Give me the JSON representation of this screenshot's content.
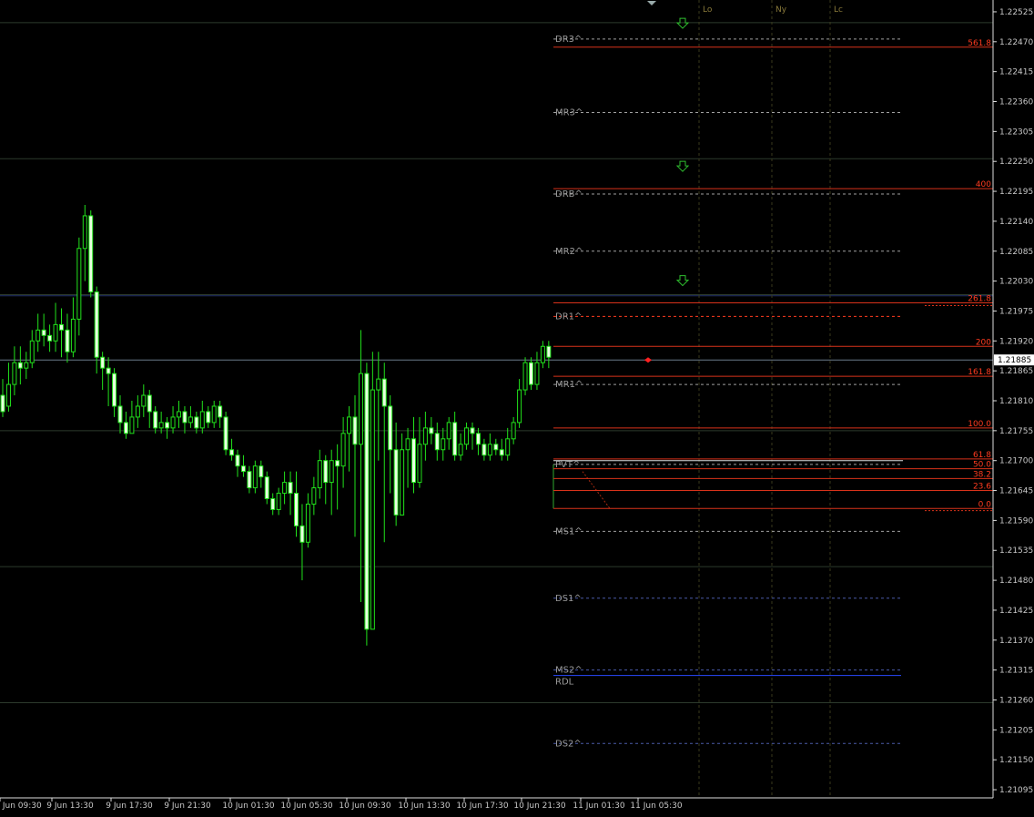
{
  "chart_data": {
    "type": "candlestick",
    "x_tick_labels": [
      "9 Jun 09:30",
      "9 Jun 13:30",
      "9 Jun 17:30",
      "9 Jun 21:30",
      "10 Jun 01:30",
      "10 Jun 05:30",
      "10 Jun 09:30",
      "10 Jun 13:30",
      "10 Jun 17:30",
      "10 Jun 21:30",
      "11 Jun 01:30",
      "11 Jun 05:30"
    ],
    "y_tick_labels": [
      "1.22525",
      "1.22470",
      "1.22415",
      "1.22360",
      "1.22305",
      "1.22250",
      "1.22195",
      "1.22140",
      "1.22085",
      "1.22030",
      "1.21975",
      "1.21920",
      "1.21865",
      "1.21810",
      "1.21755",
      "1.21700",
      "1.21645",
      "1.21590",
      "1.21535",
      "1.21480",
      "1.21425",
      "1.21370",
      "1.21315",
      "1.21260",
      "1.21205",
      "1.21150",
      "1.21095"
    ],
    "ylim": [
      1.2108,
      1.2254
    ],
    "current_price": "1.21885",
    "current_price_value": 1.21885,
    "pivot_levels": [
      {
        "label": "DR3^",
        "value": 1.22475,
        "color": "#a0a0a0",
        "style": "dashed"
      },
      {
        "label": "MR3^",
        "value": 1.2234,
        "color": "#a0a0a0",
        "style": "dashed"
      },
      {
        "label": "DRB^",
        "value": 1.2219,
        "color": "#a0a0a0",
        "style": "dashed"
      },
      {
        "label": "MR2^",
        "value": 1.22085,
        "color": "#a0a0a0",
        "style": "dashed"
      },
      {
        "label": "DR1^",
        "value": 1.21965,
        "color": "#ff3b1f",
        "style": "dashed"
      },
      {
        "label": "MR1^",
        "value": 1.2184,
        "color": "#a0a0a0",
        "style": "dashed"
      },
      {
        "label": "PVT^",
        "value": 1.21693,
        "color": "#a0a0a0",
        "style": "dashed"
      },
      {
        "label": "MS1^",
        "value": 1.2157,
        "color": "#a0a0a0",
        "style": "dashed"
      },
      {
        "label": "DS1^",
        "value": 1.21447,
        "color": "#4a5aa8",
        "style": "dashed"
      },
      {
        "label": "MS2^",
        "value": 1.21315,
        "color": "#4a5aa8",
        "style": "dashed"
      },
      {
        "label": "RDL",
        "value": 1.21305,
        "color": "#2a4aff",
        "style": "solid"
      },
      {
        "label": "DS2^",
        "value": 1.2118,
        "color": "#4a5aa8",
        "style": "dashed"
      }
    ],
    "fib_levels": [
      {
        "label": "561.8",
        "value": 1.2246
      },
      {
        "label": "400",
        "value": 1.222
      },
      {
        "label": "261.8",
        "value": 1.2199
      },
      {
        "label": "200",
        "value": 1.2191
      },
      {
        "label": "161.8",
        "value": 1.21855
      },
      {
        "label": "100.0",
        "value": 1.2176
      },
      {
        "label": "61.8",
        "value": 1.21703
      },
      {
        "label": "50.0",
        "value": 1.21685
      },
      {
        "label": "38.2",
        "value": 1.21667
      },
      {
        "label": "23.6",
        "value": 1.21645
      },
      {
        "label": "0.0",
        "value": 1.21612
      }
    ],
    "session_labels": [
      "Lo",
      "Ny",
      "Lc"
    ],
    "horizontal_grid_values": [
      1.22505,
      1.22255,
      1.22005,
      1.21755,
      1.21505,
      1.21255
    ],
    "candles": [
      [
        1.2182,
        1.2179,
        1.2185,
        1.2178
      ],
      [
        1.218,
        1.2184,
        1.2188,
        1.2179
      ],
      [
        1.2184,
        1.2188,
        1.2191,
        1.2182
      ],
      [
        1.2188,
        1.2187,
        1.2191,
        1.2184
      ],
      [
        1.2187,
        1.2188,
        1.219,
        1.2185
      ],
      [
        1.2188,
        1.2192,
        1.2194,
        1.2187
      ],
      [
        1.2192,
        1.2194,
        1.2197,
        1.219
      ],
      [
        1.2194,
        1.2193,
        1.2197,
        1.2191
      ],
      [
        1.2193,
        1.2192,
        1.2195,
        1.219
      ],
      [
        1.2192,
        1.2195,
        1.2199,
        1.219
      ],
      [
        1.2195,
        1.2194,
        1.2198,
        1.2189
      ],
      [
        1.2194,
        1.219,
        1.2197,
        1.2188
      ],
      [
        1.219,
        1.2196,
        1.22,
        1.2189
      ],
      [
        1.2196,
        1.2209,
        1.2211,
        1.2193
      ],
      [
        1.2209,
        1.2215,
        1.2217,
        1.2203
      ],
      [
        1.2215,
        1.2201,
        1.2216,
        1.22
      ],
      [
        1.2201,
        1.2189,
        1.2202,
        1.2186
      ],
      [
        1.2189,
        1.2187,
        1.219,
        1.2183
      ],
      [
        1.2187,
        1.2186,
        1.2189,
        1.218
      ],
      [
        1.2186,
        1.218,
        1.2187,
        1.2178
      ],
      [
        1.218,
        1.2177,
        1.2182,
        1.2175
      ],
      [
        1.2177,
        1.2175,
        1.2179,
        1.2174
      ],
      [
        1.2175,
        1.2178,
        1.2181,
        1.2175
      ],
      [
        1.2178,
        1.218,
        1.2182,
        1.2176
      ],
      [
        1.218,
        1.2182,
        1.2184,
        1.2178
      ],
      [
        1.2182,
        1.2179,
        1.2183,
        1.2176
      ],
      [
        1.2179,
        1.2176,
        1.218,
        1.2175
      ],
      [
        1.2176,
        1.2177,
        1.2179,
        1.2175
      ],
      [
        1.2177,
        1.2176,
        1.2178,
        1.2174
      ],
      [
        1.2176,
        1.2178,
        1.218,
        1.2175
      ],
      [
        1.2178,
        1.2179,
        1.2181,
        1.2176
      ],
      [
        1.2179,
        1.2177,
        1.218,
        1.2175
      ],
      [
        1.2177,
        1.2178,
        1.218,
        1.2176
      ],
      [
        1.2178,
        1.2176,
        1.2179,
        1.2175
      ],
      [
        1.2176,
        1.2179,
        1.2181,
        1.2175
      ],
      [
        1.2179,
        1.2177,
        1.218,
        1.2176
      ],
      [
        1.2177,
        1.218,
        1.2181,
        1.2176
      ],
      [
        1.218,
        1.2178,
        1.2181,
        1.2176
      ],
      [
        1.2178,
        1.2172,
        1.2179,
        1.2171
      ],
      [
        1.2172,
        1.2171,
        1.2174,
        1.217
      ],
      [
        1.2171,
        1.2169,
        1.2172,
        1.2167
      ],
      [
        1.2169,
        1.2168,
        1.2171,
        1.2167
      ],
      [
        1.2168,
        1.2165,
        1.2169,
        1.2164
      ],
      [
        1.2165,
        1.2169,
        1.217,
        1.2164
      ],
      [
        1.2169,
        1.2167,
        1.217,
        1.2165
      ],
      [
        1.2167,
        1.2163,
        1.2168,
        1.2162
      ],
      [
        1.2163,
        1.2161,
        1.2164,
        1.216
      ],
      [
        1.2161,
        1.2164,
        1.2165,
        1.216
      ],
      [
        1.2164,
        1.2166,
        1.2168,
        1.2162
      ],
      [
        1.2166,
        1.2164,
        1.2168,
        1.216
      ],
      [
        1.2164,
        1.2158,
        1.2168,
        1.2156
      ],
      [
        1.2158,
        1.2155,
        1.2162,
        1.2148
      ],
      [
        1.2155,
        1.2162,
        1.2164,
        1.2154
      ],
      [
        1.2162,
        1.2165,
        1.2167,
        1.216
      ],
      [
        1.2165,
        1.217,
        1.2172,
        1.2163
      ],
      [
        1.217,
        1.2166,
        1.2171,
        1.2162
      ],
      [
        1.2166,
        1.217,
        1.2172,
        1.216
      ],
      [
        1.217,
        1.2169,
        1.2173,
        1.2161
      ],
      [
        1.2169,
        1.2175,
        1.2178,
        1.2165
      ],
      [
        1.2175,
        1.2178,
        1.218,
        1.2168
      ],
      [
        1.2178,
        1.2173,
        1.2182,
        1.2156
      ],
      [
        1.2173,
        1.2186,
        1.2194,
        1.2144
      ],
      [
        1.2186,
        1.2139,
        1.2188,
        1.2136
      ],
      [
        1.2139,
        1.2183,
        1.219,
        1.214
      ],
      [
        1.2183,
        1.2185,
        1.219,
        1.217
      ],
      [
        1.2185,
        1.218,
        1.2188,
        1.2155
      ],
      [
        1.218,
        1.2172,
        1.2182,
        1.2164
      ],
      [
        1.2172,
        1.216,
        1.2177,
        1.2158
      ],
      [
        1.216,
        1.2172,
        1.2175,
        1.2161
      ],
      [
        1.2172,
        1.2174,
        1.2176,
        1.2165
      ],
      [
        1.2174,
        1.2166,
        1.2178,
        1.2164
      ],
      [
        1.2166,
        1.2173,
        1.2178,
        1.2165
      ],
      [
        1.2173,
        1.2176,
        1.2179,
        1.217
      ],
      [
        1.2176,
        1.2175,
        1.2178,
        1.2173
      ],
      [
        1.2175,
        1.2172,
        1.2177,
        1.217
      ],
      [
        1.2172,
        1.2174,
        1.2176,
        1.217
      ],
      [
        1.2174,
        1.2177,
        1.2178,
        1.2172
      ],
      [
        1.2177,
        1.2171,
        1.2179,
        1.217
      ],
      [
        1.2171,
        1.2173,
        1.2175,
        1.217
      ],
      [
        1.2173,
        1.2176,
        1.2177,
        1.2172
      ],
      [
        1.2176,
        1.2175,
        1.2177,
        1.2172
      ],
      [
        1.2175,
        1.2173,
        1.2176,
        1.2171
      ],
      [
        1.2173,
        1.2171,
        1.2174,
        1.217
      ],
      [
        1.2171,
        1.2173,
        1.2175,
        1.217
      ],
      [
        1.2173,
        1.2172,
        1.2174,
        1.2171
      ],
      [
        1.2172,
        1.2171,
        1.2174,
        1.217
      ],
      [
        1.2171,
        1.2174,
        1.2176,
        1.217
      ],
      [
        1.2174,
        1.2177,
        1.2178,
        1.2173
      ],
      [
        1.2177,
        1.2183,
        1.2185,
        1.2176
      ],
      [
        1.2183,
        1.2188,
        1.2189,
        1.2182
      ],
      [
        1.2188,
        1.2184,
        1.2189,
        1.2183
      ],
      [
        1.2184,
        1.2188,
        1.219,
        1.2183
      ],
      [
        1.2188,
        1.2191,
        1.2192,
        1.2187
      ],
      [
        1.2191,
        1.2189,
        1.2192,
        1.2187
      ]
    ]
  }
}
